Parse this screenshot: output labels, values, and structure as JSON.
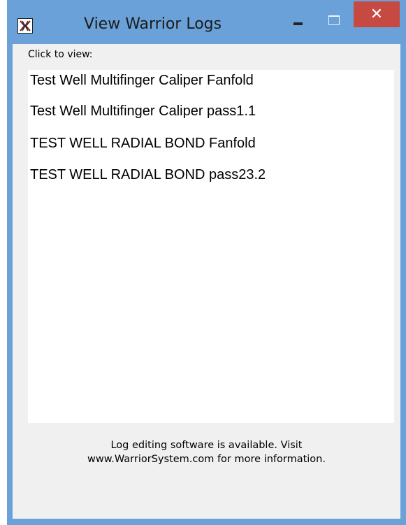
{
  "window": {
    "title": "View Warrior Logs",
    "close_glyph": "✕",
    "icons": [
      "app-icon",
      "minimize-icon",
      "maximize-icon",
      "close-icon"
    ]
  },
  "prompt": "Click to view:",
  "logs": [
    "Test Well Multifinger Caliper Fanfold",
    "Test Well Multifinger Caliper pass1.1",
    "TEST WELL RADIAL BOND Fanfold",
    "TEST WELL RADIAL BOND pass23.2"
  ],
  "footer": {
    "line1": "Log editing software is available. Visit",
    "line2": "www.WarriorSystem.com for more information."
  },
  "colors": {
    "frame": "#6ba1d9",
    "close_button": "#c74a42",
    "client": "#f0f0f0",
    "list_background": "#ffffff"
  }
}
